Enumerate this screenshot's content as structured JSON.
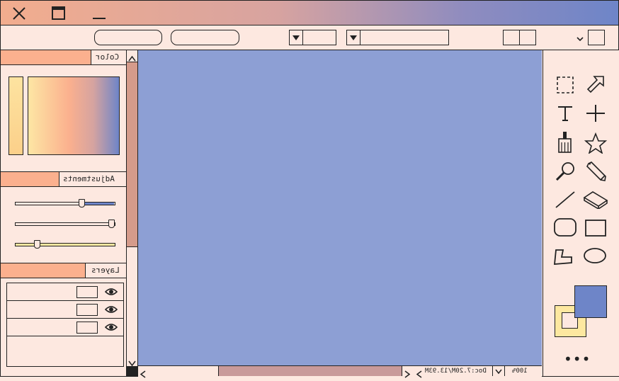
{
  "colors": {
    "title_gradient": [
      "#f2ad8e",
      "#d7a3a0",
      "#8f8cbf",
      "#6e85c8"
    ],
    "canvas": "#8d9fd4",
    "panel_bg": "#fde8e0",
    "accent_tab": "#fbb08e",
    "swatch_fg": "#6e85c8",
    "swatch_bg": "#fde8a0"
  },
  "titlebar": {
    "icons": [
      "close-icon",
      "maximize-icon",
      "minimize-icon"
    ]
  },
  "panels": {
    "color": {
      "title": "Color"
    },
    "adjustments": {
      "title": "Adjustments",
      "sliders": [
        {
          "value": 0.67,
          "fill": "#6e85c8"
        },
        {
          "value": 1.0,
          "fill": "#fde8e0"
        },
        {
          "value": 0.22,
          "fill": "#f7e6a0"
        }
      ]
    },
    "layers": {
      "title": "Layers",
      "rows": [
        {
          "visible": true
        },
        {
          "visible": true
        },
        {
          "visible": true
        },
        {
          "visible": false
        }
      ]
    }
  },
  "status": {
    "zoom": "100%",
    "doc_info": "Doc:7.20M/13.93M"
  },
  "tools": [
    "marquee-select-icon",
    "arrow-cursor-icon",
    "text-tool-icon",
    "crosshair-icon",
    "brush-icon",
    "star-icon",
    "zoom-icon",
    "pencil-icon",
    "line-icon",
    "eraser-icon",
    "rounded-rect-icon",
    "rectangle-icon",
    "polygon-icon",
    "ellipse-icon"
  ],
  "more_label": "•••"
}
